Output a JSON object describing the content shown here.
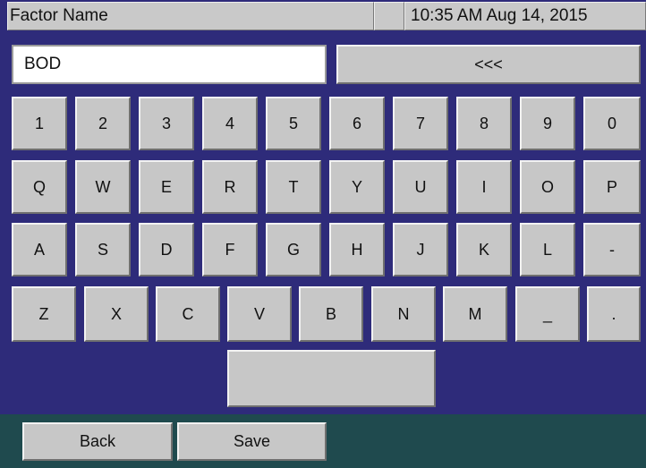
{
  "header": {
    "title": "Factor Name",
    "clock": "10:35 AM Aug 14, 2015"
  },
  "entry": {
    "value": "BOD",
    "backspace_label": "<<<"
  },
  "keyboard": {
    "row1": [
      "1",
      "2",
      "3",
      "4",
      "5",
      "6",
      "7",
      "8",
      "9",
      "0"
    ],
    "row2": [
      "Q",
      "W",
      "E",
      "R",
      "T",
      "Y",
      "U",
      "I",
      "O",
      "P"
    ],
    "row3": [
      "A",
      "S",
      "D",
      "F",
      "G",
      "H",
      "J",
      "K",
      "L",
      "-"
    ],
    "row4": [
      "Z",
      "X",
      "C",
      "V",
      "B",
      "N",
      "M",
      "_",
      "."
    ],
    "space_label": ""
  },
  "footer": {
    "back_label": "Back",
    "save_label": "Save"
  },
  "colors": {
    "background": "#2e2b7a",
    "footer": "#1f4a4e",
    "key": "#c7c7c7"
  }
}
